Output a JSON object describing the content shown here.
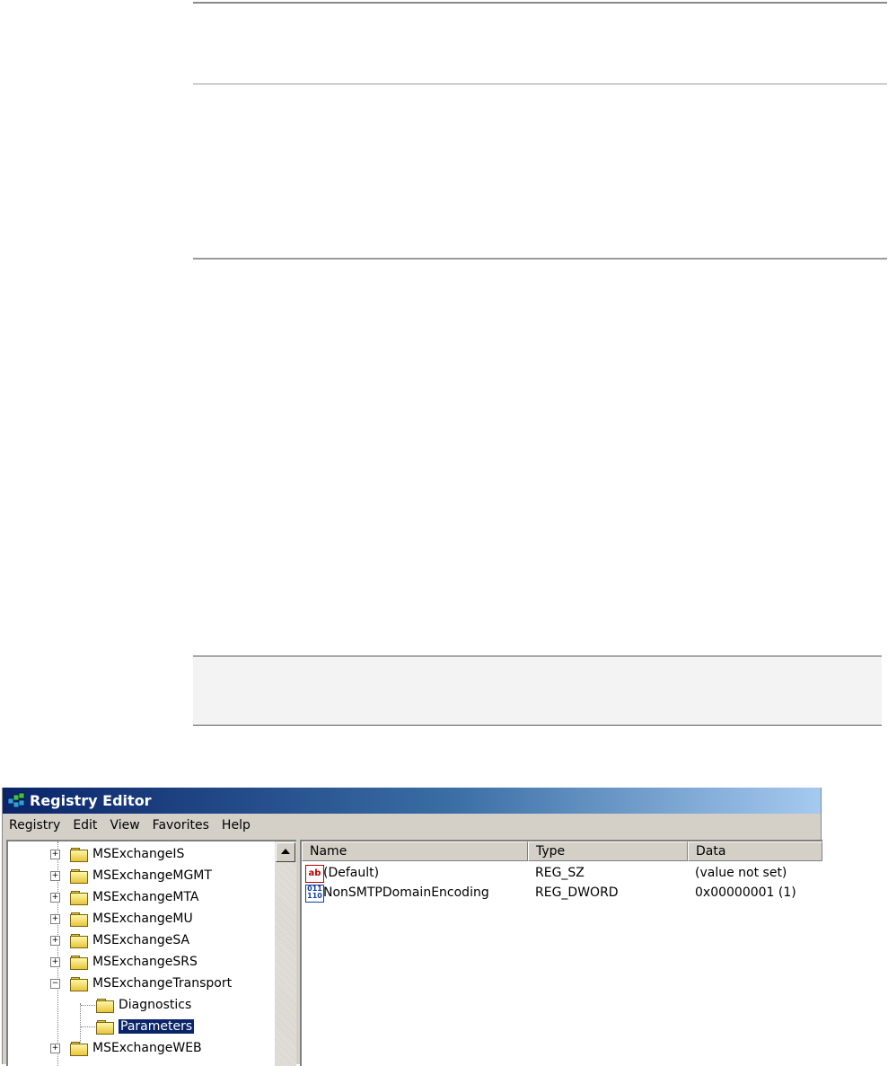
{
  "window": {
    "title": "Registry Editor"
  },
  "menu": [
    "Registry",
    "Edit",
    "View",
    "Favorites",
    "Help"
  ],
  "tree": {
    "items": [
      {
        "label": "MSExchangeIS",
        "expander": "+",
        "level": 0
      },
      {
        "label": "MSExchangeMGMT",
        "expander": "+",
        "level": 0
      },
      {
        "label": "MSExchangeMTA",
        "expander": "+",
        "level": 0
      },
      {
        "label": "MSExchangeMU",
        "expander": "+",
        "level": 0
      },
      {
        "label": "MSExchangeSA",
        "expander": "+",
        "level": 0
      },
      {
        "label": "MSExchangeSRS",
        "expander": "+",
        "level": 0
      },
      {
        "label": "MSExchangeTransport",
        "expander": "−",
        "level": 0
      },
      {
        "label": "Diagnostics",
        "expander": "",
        "level": 1
      },
      {
        "label": "Parameters",
        "expander": "",
        "level": 1,
        "selected": true
      },
      {
        "label": "MSExchangeWEB",
        "expander": "+",
        "level": 0
      }
    ]
  },
  "list": {
    "columns": [
      "Name",
      "Type",
      "Data"
    ],
    "rows": [
      {
        "icon": "string-value-icon",
        "icon_text": "ab",
        "name": "(Default)",
        "type": "REG_SZ",
        "data": "(value not set)"
      },
      {
        "icon": "dword-value-icon",
        "icon_text": "011\n110",
        "name": "NonSMTPDomainEncoding",
        "type": "REG_DWORD",
        "data": "0x00000001 (1)"
      }
    ]
  },
  "colors": {
    "titlebar_start": "#0a246a",
    "titlebar_end": "#a6caf0",
    "selection": "#0a246a",
    "chrome": "#d4d0c8"
  }
}
